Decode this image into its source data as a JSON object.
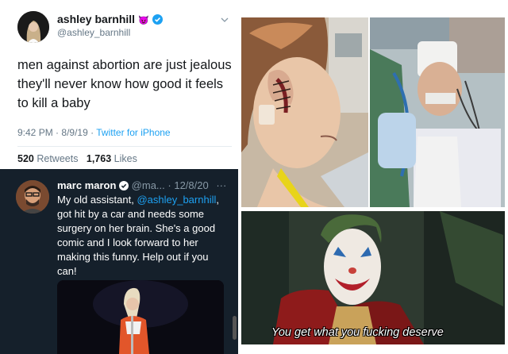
{
  "tweet_top": {
    "display_name": "ashley barnhill",
    "name_emoji": "😈",
    "handle": "@ashley_barnhill",
    "text": "men against abortion are just jealous they'll never know how good it feels to kill a baby",
    "time": "9:42 PM",
    "date": "8/9/19",
    "source": "Twitter for iPhone",
    "retweets_count": "520",
    "retweets_label": "Retweets",
    "likes_count": "1,763",
    "likes_label": "Likes"
  },
  "tweet_reply": {
    "display_name": "marc maron",
    "handle": "@ma...",
    "date": "12/8/20",
    "more": "···",
    "text_before": "My old assistant, ",
    "mention": "@ashley_barnhill",
    "text_after": ", got hit by a car and needs some surgery on her brain. She's a good comic and I look forward to her making this funny.  Help out if you can!"
  },
  "meme_caption": "You get what you fucking deserve",
  "colors": {
    "twitter_blue": "#1da1f2",
    "dark_bg": "#15202b",
    "muted_text": "#657786"
  }
}
